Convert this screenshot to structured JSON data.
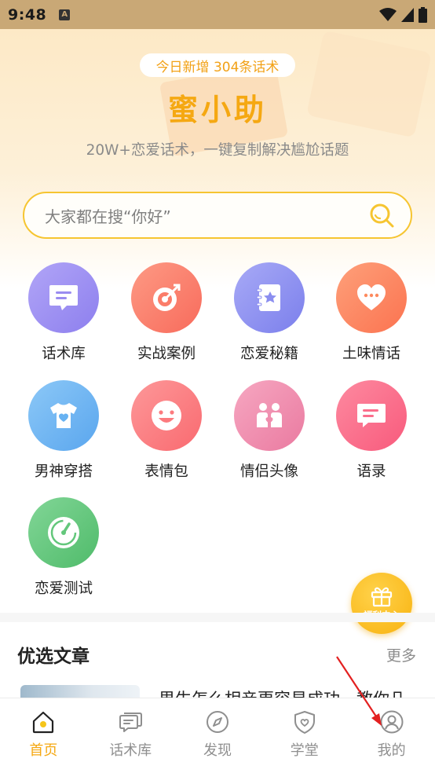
{
  "status_bar": {
    "time": "9:48",
    "notification_letter": "A"
  },
  "hero": {
    "new_badge": "今日新增 304条话术",
    "app_title": "蜜小助",
    "subtitle": "20W+恋爱话术，一键复制解决尴尬话题"
  },
  "search": {
    "placeholder": "大家都在搜“你好”"
  },
  "grid": [
    {
      "label": "话术库",
      "icon": "chat-bubble-icon",
      "color": "#9a8cf0"
    },
    {
      "label": "实战案例",
      "icon": "target-icon",
      "color": "#fb7d6a"
    },
    {
      "label": "恋爱秘籍",
      "icon": "notebook-star-icon",
      "color": "#8b8ef0"
    },
    {
      "label": "土味情话",
      "icon": "heart-dots-icon",
      "color": "#fd8a5e"
    },
    {
      "label": "男神穿搭",
      "icon": "tshirt-icon",
      "color": "#67b2f2"
    },
    {
      "label": "表情包",
      "icon": "smiley-icon",
      "color": "#fc7a7e"
    },
    {
      "label": "情侣头像",
      "icon": "couple-icon",
      "color": "#f08dad"
    },
    {
      "label": "语录",
      "icon": "quote-bubble-icon",
      "color": "#fb6e8c"
    },
    {
      "label": "恋爱测试",
      "icon": "gauge-icon",
      "color": "#63c77b"
    }
  ],
  "welfare": {
    "label": "福利中心"
  },
  "articles": {
    "section_title": "优选文章",
    "more_label": "更多",
    "first_title": "男生怎么相亲更容易成功，教你几"
  },
  "bottom_nav": [
    {
      "label": "首页",
      "icon": "home-icon",
      "active": true
    },
    {
      "label": "话术库",
      "icon": "chat-bubbles-icon",
      "active": false
    },
    {
      "label": "发现",
      "icon": "compass-icon",
      "active": false
    },
    {
      "label": "学堂",
      "icon": "shield-heart-icon",
      "active": false
    },
    {
      "label": "我的",
      "icon": "user-icon",
      "active": false
    }
  ],
  "colors": {
    "accent": "#f5a812",
    "arrow": "#e32020"
  }
}
